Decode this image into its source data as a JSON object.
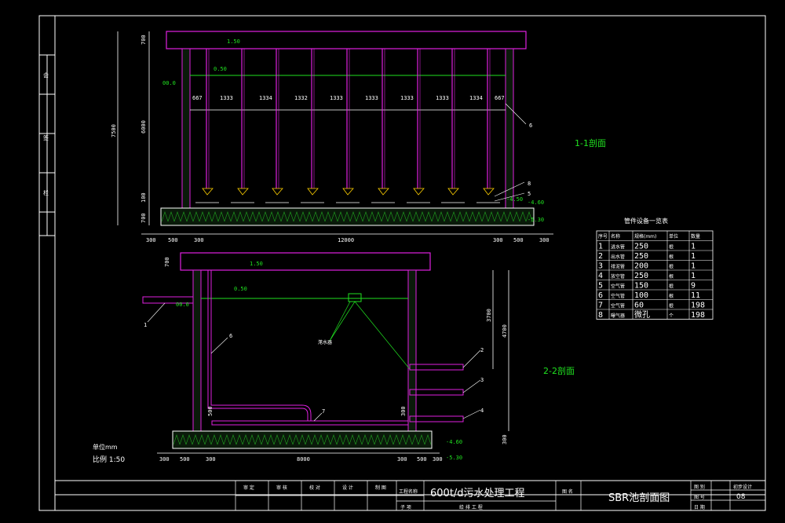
{
  "section_1": {
    "label": "1-1剖面",
    "dims_top": [
      "667",
      "1333",
      "1334",
      "1332",
      "1333",
      "1333",
      "1333",
      "1333",
      "1334",
      "667"
    ],
    "dims_bottom": [
      "300",
      "500",
      "300",
      "12000",
      "300",
      "500",
      "300"
    ],
    "dims_left": [
      "700",
      "7500",
      "6000",
      "100",
      "700"
    ],
    "levels": [
      "1.50",
      "0.50",
      "00.0",
      "-4.50",
      "-4.60",
      "-5.30"
    ],
    "callouts": [
      "6",
      "8",
      "5"
    ]
  },
  "section_2": {
    "label": "2-2剖面",
    "dims_bottom": [
      "300",
      "500",
      "300",
      "8000",
      "300",
      "500",
      "300"
    ],
    "dims_left": [
      "700"
    ],
    "dims_right": [
      "3700",
      "4700",
      "300"
    ],
    "inner_dims": [
      "500",
      "300"
    ],
    "levels": [
      "1.50",
      "0.50",
      "00.0",
      "-4.60",
      "-5.30"
    ],
    "callouts": [
      "1",
      "6",
      "2",
      "3",
      "4",
      "7"
    ],
    "note": "滗水器"
  },
  "scale_note": {
    "unit": "单位mm",
    "ratio": "比例 1:50"
  },
  "equipment_table": {
    "title": "管件设备一览表",
    "headers": [
      "序号",
      "名称",
      "规格(mm)",
      "单位",
      "数量"
    ],
    "rows": [
      [
        "1",
        "进水管",
        "250",
        "根",
        "1"
      ],
      [
        "2",
        "出水管",
        "250",
        "根",
        "1"
      ],
      [
        "3",
        "排泥管",
        "200",
        "根",
        "1"
      ],
      [
        "4",
        "放空管",
        "250",
        "根",
        "1"
      ],
      [
        "5",
        "空气管",
        "150",
        "根",
        "9"
      ],
      [
        "6",
        "空气管",
        "100",
        "根",
        "11"
      ],
      [
        "7",
        "空气管",
        "60",
        "根",
        "198"
      ],
      [
        "8",
        "曝气器",
        "微孔",
        "个",
        "198"
      ]
    ]
  },
  "title_block": {
    "roles": [
      "审 定",
      "审 核",
      "校 对",
      "设 计",
      "制 图"
    ],
    "project_label": "工程名称",
    "project_name": "600t/d污水处理工程",
    "subproject_label": "子 项",
    "subproject": "给 排 工 程",
    "drawing_label": "图 名",
    "drawing_name": "SBR池剖面图",
    "meta_labels": [
      "图 别",
      "图 号",
      "日 期"
    ],
    "meta_values": [
      "初步设计",
      "08",
      ""
    ]
  },
  "left_strip": [
    "会",
    "签",
    "栏"
  ]
}
